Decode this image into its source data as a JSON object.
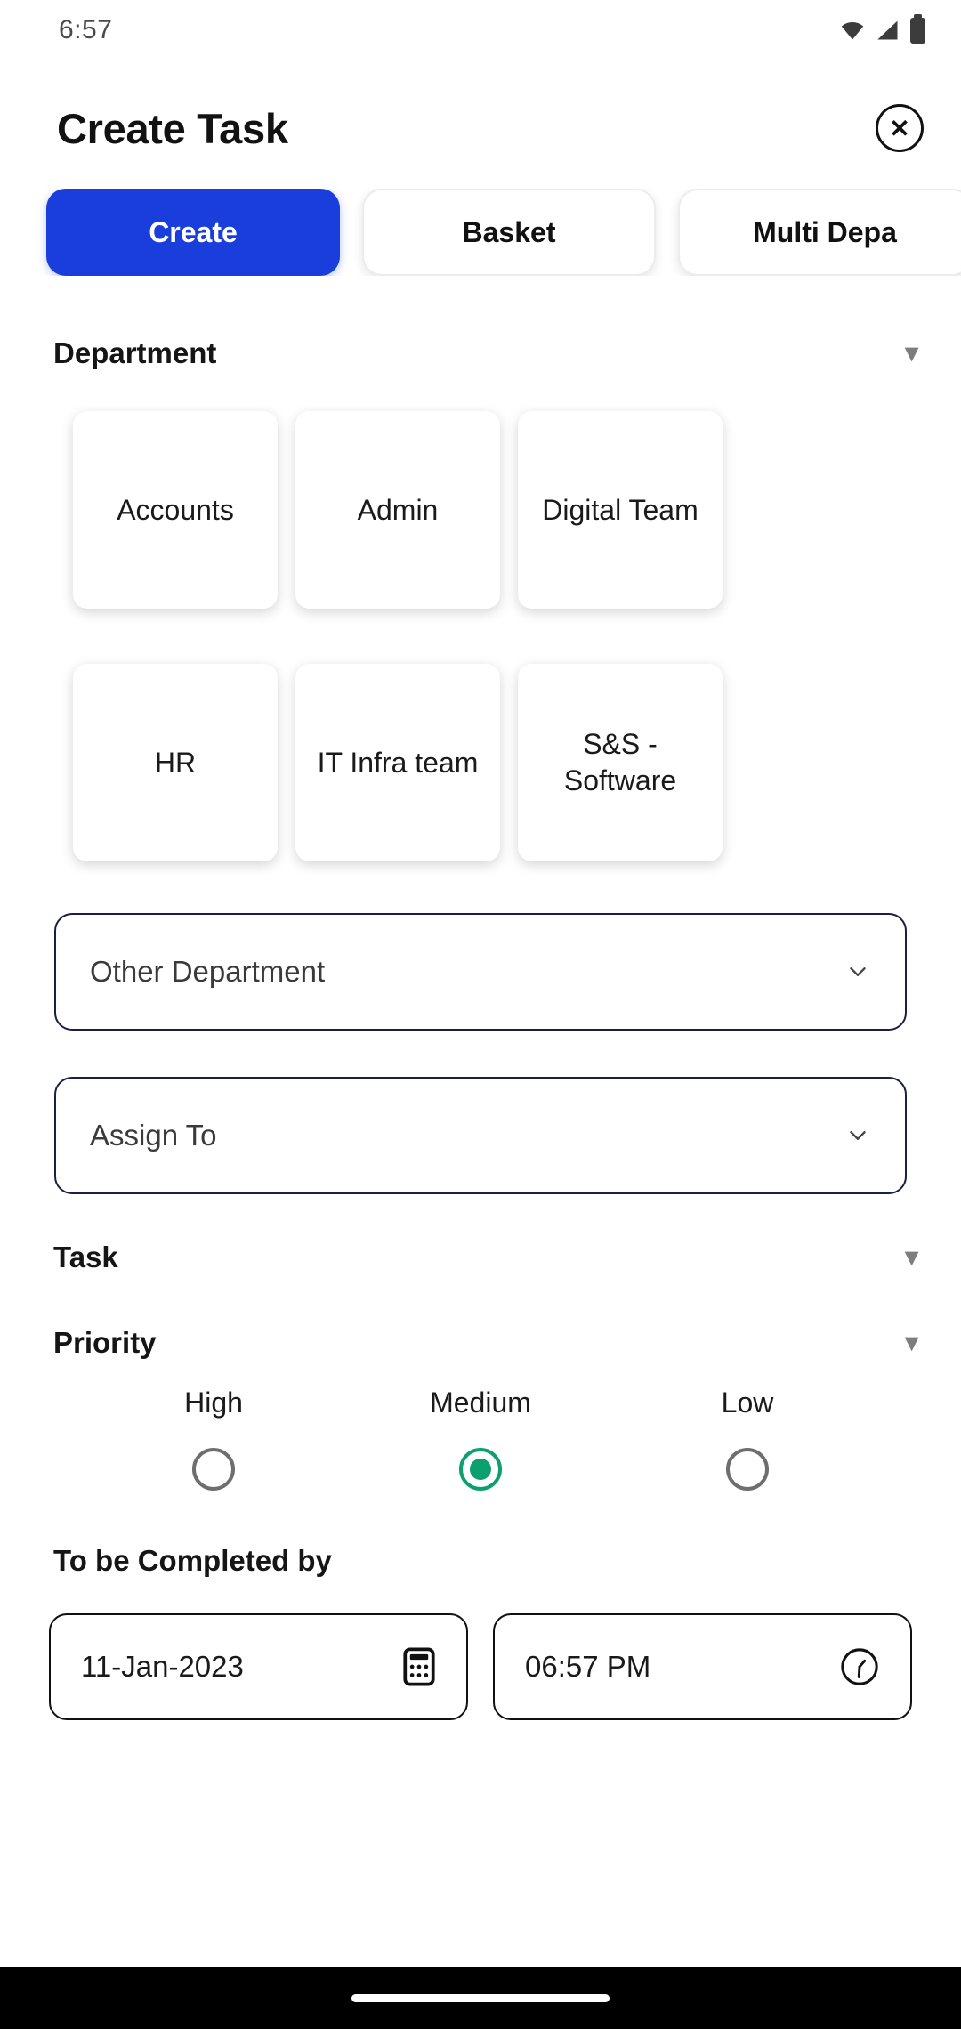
{
  "status_bar": {
    "time": "6:57",
    "icons": [
      "wifi-icon",
      "signal-icon",
      "battery-icon"
    ]
  },
  "header": {
    "title": "Create Task",
    "close_label": "✕"
  },
  "tabs": [
    {
      "label": "Create",
      "active": true
    },
    {
      "label": "Basket",
      "active": false
    },
    {
      "label": "Multi Depa",
      "active": false
    }
  ],
  "sections": {
    "department": {
      "title": "Department",
      "caret": "▼"
    },
    "task": {
      "title": "Task",
      "caret": "▼"
    },
    "priority": {
      "title": "Priority",
      "caret": "▼"
    },
    "completed_by": {
      "title": "To be Completed by"
    }
  },
  "departments": [
    {
      "label": "Accounts"
    },
    {
      "label": "Admin"
    },
    {
      "label": "Digital Team"
    },
    {
      "label": "HR"
    },
    {
      "label": "IT Infra team"
    },
    {
      "label": "S&S - Software"
    }
  ],
  "dropdowns": {
    "other_department": {
      "value": "Other Department"
    },
    "assign_to": {
      "value": "Assign To"
    }
  },
  "priority": {
    "options": [
      {
        "label": "High",
        "selected": false
      },
      {
        "label": "Medium",
        "selected": true
      },
      {
        "label": "Low",
        "selected": false
      }
    ],
    "selected_color": "#0BA06E",
    "unselected_color": "#6E6E6E"
  },
  "due": {
    "date_value": "11-Jan-2023",
    "date_icon": "calendar-icon",
    "time_value": "06:57 PM",
    "time_icon": "clock-icon"
  },
  "colors": {
    "accent_blue": "#1A3EDB",
    "field_border": "#1B1F47",
    "text_primary": "#121212"
  }
}
